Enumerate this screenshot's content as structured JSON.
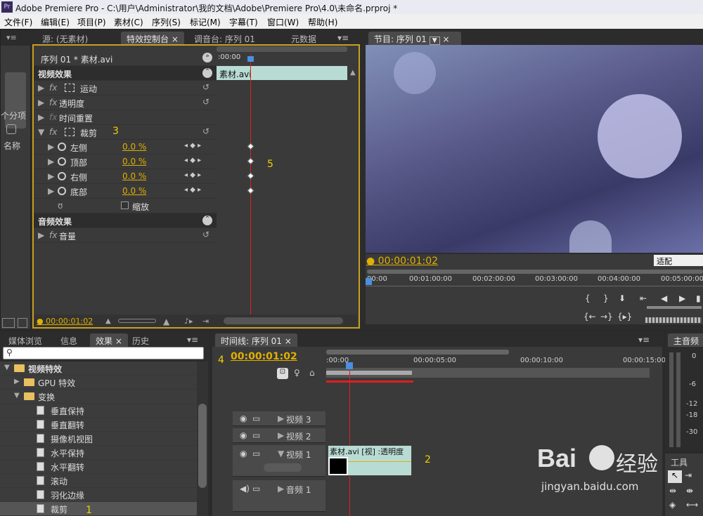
{
  "app": {
    "title": "Adobe Premiere Pro - C:\\用户\\Administrator\\我的文档\\Adobe\\Premiere Pro\\4.0\\未命名.prproj *",
    "logo": "Pr"
  },
  "menu": [
    "文件(F)",
    "编辑(E)",
    "项目(P)",
    "素材(C)",
    "序列(S)",
    "标记(M)",
    "字幕(T)",
    "窗口(W)",
    "帮助(H)"
  ],
  "top_tabs": {
    "source": "源: (无素材)",
    "effect_controls": "特效控制台",
    "audio_mixer": "调音台: 序列 01",
    "metadata": "元数据",
    "program": "节目: 序列 01"
  },
  "left_stub": {
    "a": "个分项",
    "b": "名称"
  },
  "effect_controls": {
    "clip_header": "序列 01 * 素材.avi",
    "start_time": ":00:00",
    "clip_name": "素材.avi",
    "video_effects": "视频效果",
    "motion": "运动",
    "opacity": "透明度",
    "time_remap": "时间重置",
    "crop": "裁剪",
    "params": [
      {
        "label": "左侧",
        "value": "0.0 %"
      },
      {
        "label": "顶部",
        "value": "0.0 %"
      },
      {
        "label": "右侧",
        "value": "0.0 %"
      },
      {
        "label": "底部",
        "value": "0.0 %"
      }
    ],
    "zoom": "缩放",
    "audio_effects": "音频效果",
    "volume": "音量",
    "timecode": "00:00:01:02"
  },
  "program": {
    "timecode": "00:00:01:02",
    "fit": "适配",
    "ruler": [
      "00:00",
      "00:01:00:00",
      "00:02:00:00",
      "00:03:00:00",
      "00:04:00:00",
      "00:05:00:00"
    ]
  },
  "bottom_tabs": {
    "media": "媒体浏览",
    "info": "信息",
    "effects": "效果",
    "history": "历史",
    "timeline": "时间线: 序列 01",
    "master": "主音频"
  },
  "effects_tree": [
    {
      "label": "视频特效",
      "level": 0,
      "type": "folder",
      "bold": true
    },
    {
      "label": "GPU 特效",
      "level": 1,
      "type": "folder"
    },
    {
      "label": "变换",
      "level": 1,
      "type": "folder"
    },
    {
      "label": "垂直保持",
      "level": 2,
      "type": "file"
    },
    {
      "label": "垂直翻转",
      "level": 2,
      "type": "file"
    },
    {
      "label": "摄像机视图",
      "level": 2,
      "type": "file"
    },
    {
      "label": "水平保持",
      "level": 2,
      "type": "file"
    },
    {
      "label": "水平翻转",
      "level": 2,
      "type": "file"
    },
    {
      "label": "滚动",
      "level": 2,
      "type": "file"
    },
    {
      "label": "羽化边缘",
      "level": 2,
      "type": "file"
    },
    {
      "label": "裁剪",
      "level": 2,
      "type": "file"
    }
  ],
  "timeline": {
    "timecode": "00:00:01:02",
    "ruler": [
      ":00:00",
      "00:00:05:00",
      "00:00:10:00",
      "00:00:15:00"
    ],
    "tracks": [
      "视频 3",
      "视频 2",
      "视频 1",
      "音频 1"
    ],
    "clip_label": "素材.avi [视] :透明度"
  },
  "meter": [
    "0",
    "-6",
    "-12",
    "-18",
    "-30"
  ],
  "tools": "工具",
  "annotations": [
    "1",
    "2",
    "3",
    "4",
    "5"
  ],
  "watermark": {
    "brand": "Bai",
    "brand2": "经验",
    "url": "jingyan.baidu.com"
  },
  "colors": {
    "accent": "#e0b000",
    "playhead": "#e02020",
    "clip": "#b8dcd4"
  }
}
